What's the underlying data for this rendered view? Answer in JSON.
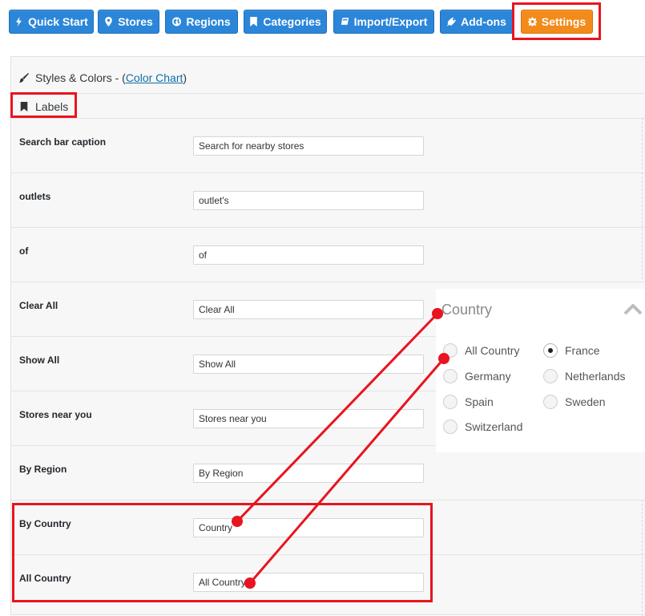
{
  "nav": {
    "buttons": [
      {
        "label": "Quick Start",
        "icon": "lightning-icon"
      },
      {
        "label": "Stores",
        "icon": "map-pin-icon"
      },
      {
        "label": "Regions",
        "icon": "globe-icon"
      },
      {
        "label": "Categories",
        "icon": "bookmark-icon"
      },
      {
        "label": "Import/Export",
        "icon": "book-icon"
      },
      {
        "label": "Add-ons",
        "icon": "plug-icon"
      },
      {
        "label": "Settings",
        "icon": "gear-icon",
        "active": true
      }
    ]
  },
  "panel": {
    "styles_prefix": "Styles & Colors - (",
    "color_chart_link": "Color Chart",
    "styles_suffix": ")",
    "labels_heading": "Labels",
    "rows": [
      {
        "label": "Search bar caption",
        "value": "Search for nearby stores"
      },
      {
        "label": "outlets",
        "value": "outlet's"
      },
      {
        "label": "of",
        "value": "of"
      },
      {
        "label": "Clear All",
        "value": "Clear All"
      },
      {
        "label": "Show All",
        "value": "Show All"
      },
      {
        "label": "Stores near you",
        "value": "Stores near you"
      },
      {
        "label": "By Region",
        "value": "By Region"
      },
      {
        "label": "By Country",
        "value": "Country"
      },
      {
        "label": "All Country",
        "value": "All Country"
      }
    ]
  },
  "popup": {
    "title": "Country",
    "options": [
      {
        "label": "All Country",
        "checked": false
      },
      {
        "label": "France",
        "checked": true
      },
      {
        "label": "Germany",
        "checked": false
      },
      {
        "label": "Netherlands",
        "checked": false
      },
      {
        "label": "Spain",
        "checked": false
      },
      {
        "label": "Sweden",
        "checked": false
      },
      {
        "label": "Switzerland",
        "checked": false
      }
    ]
  },
  "colors": {
    "nav_blue": "#2b86d9",
    "nav_active_orange": "#f38b1b",
    "highlight_red": "#e8141f",
    "link_blue": "#0f6fa6"
  }
}
